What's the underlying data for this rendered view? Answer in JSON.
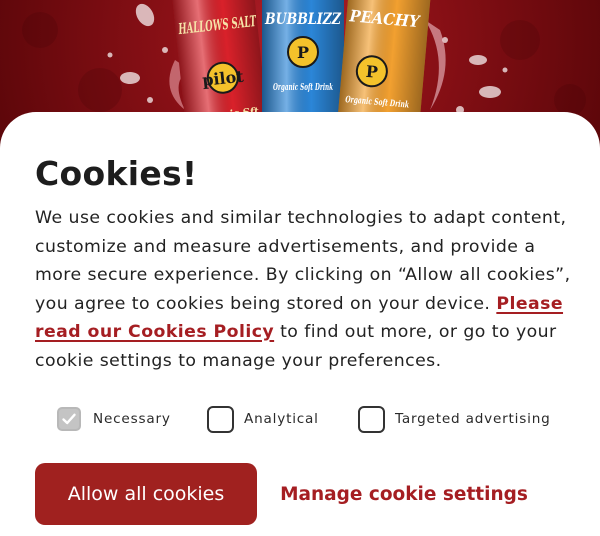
{
  "hero": {
    "cans": [
      {
        "label": "HALLOWS SALT",
        "brand": "pilot",
        "footer": "Organic Sft"
      },
      {
        "label": "BUBBLIZZ",
        "brand": "P",
        "footer": "Organic Soft Drink"
      },
      {
        "label": "PEACHY",
        "brand": "P",
        "footer": "Organic Soft Drink"
      }
    ],
    "can_colors": [
      "#d9212a",
      "#2b86d8",
      "#f2a030"
    ]
  },
  "cookie_banner": {
    "title": "Cookies!",
    "intro": "We use cookies and similar technologies to adapt content, customize and measure advertisements, and provide a more secure experience. By clicking on “Allow all cookies”, you agree to cookies being stored on your device.",
    "policy_link": "Please read our Cookies Policy",
    "outro": " to find out more, or go to your cookie settings to manage your preferences.",
    "options": [
      {
        "label": "Necessary",
        "checked": true,
        "disabled": true
      },
      {
        "label": "Analytical",
        "checked": false,
        "disabled": false
      },
      {
        "label": "Targeted advertising",
        "checked": false,
        "disabled": false
      }
    ],
    "allow_all_label": "Allow all cookies",
    "manage_label": "Manage cookie settings"
  },
  "colors": {
    "accent": "#a0211f",
    "link": "#a51e22",
    "text": "#222222"
  }
}
